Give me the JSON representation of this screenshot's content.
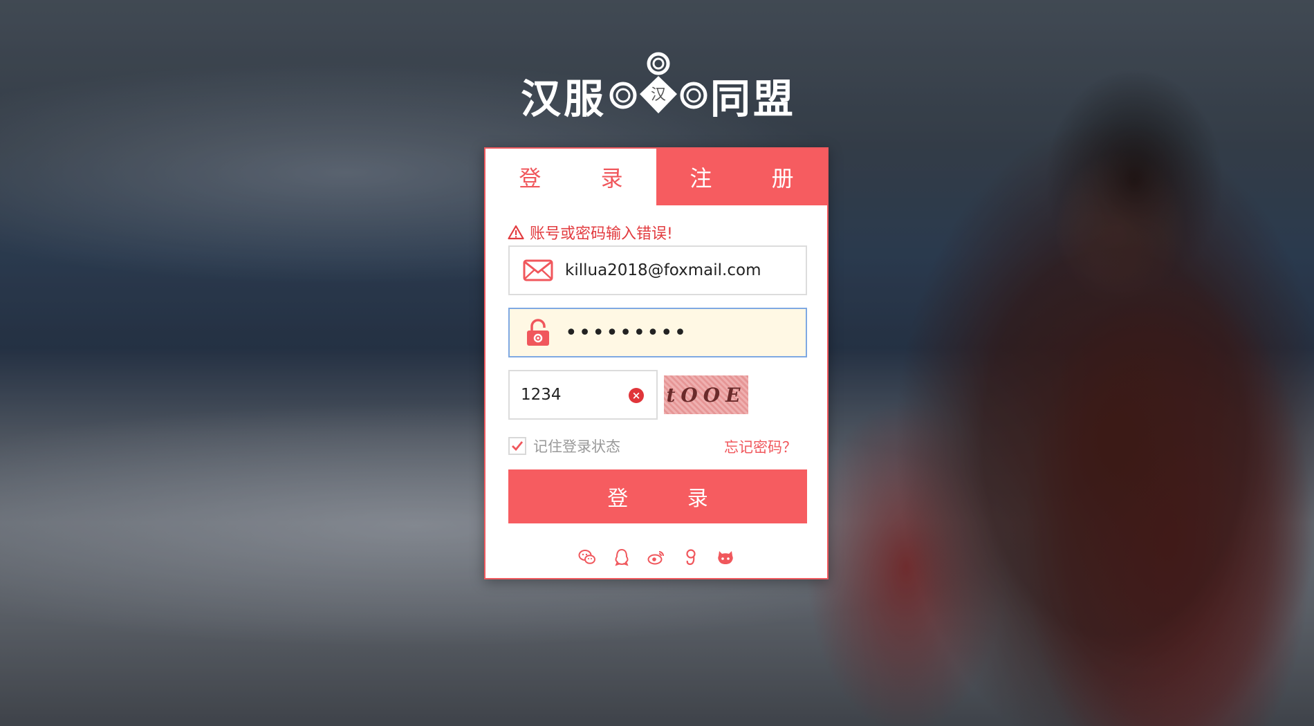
{
  "brand": {
    "left": "汉服",
    "emblem": "汉",
    "right": "同盟"
  },
  "tabs": {
    "login": "登 录",
    "register": "注 册"
  },
  "form": {
    "error": "账号或密码输入错误!",
    "email_value": "killua2018@foxmail.com",
    "password_value": "•••••••••",
    "captcha_value": "1234",
    "captcha_text": "tOOE",
    "remember_label": "记住登录状态",
    "remember_checked": true,
    "forgot": "忘记密码？",
    "submit": "登 录"
  },
  "social": [
    "wechat-icon",
    "qq-icon",
    "weibo-icon",
    "google-icon",
    "github-icon"
  ],
  "colors": {
    "accent": "#f65c60",
    "error": "#e23b3f",
    "password_bg": "#fff8e4"
  }
}
